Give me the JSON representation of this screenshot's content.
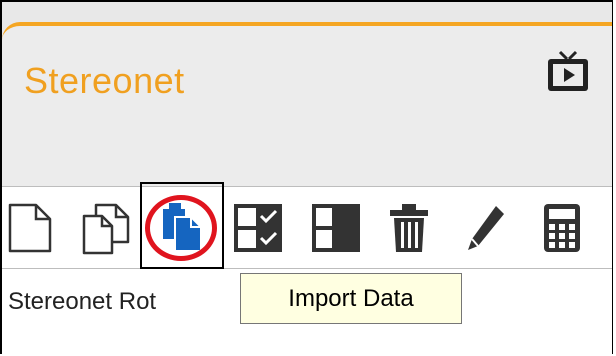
{
  "app": {
    "title": "Stereonet"
  },
  "toolbar": {
    "items": [
      {
        "name": "new-file-icon"
      },
      {
        "name": "copy-icon"
      },
      {
        "name": "import-data-icon",
        "highlighted": true
      },
      {
        "name": "checklist-icon"
      },
      {
        "name": "split-view-icon"
      },
      {
        "name": "trash-icon"
      },
      {
        "name": "pencil-icon"
      },
      {
        "name": "calculator-icon"
      }
    ]
  },
  "content": {
    "label": "Stereonet Rot"
  },
  "tooltip": {
    "text": "Import Data"
  },
  "colors": {
    "title": "#f0a020",
    "accent_border": "#f5a623",
    "import_icon": "#1565c0",
    "highlight_circle": "#e0141e",
    "tooltip_bg": "#ffffe1"
  }
}
